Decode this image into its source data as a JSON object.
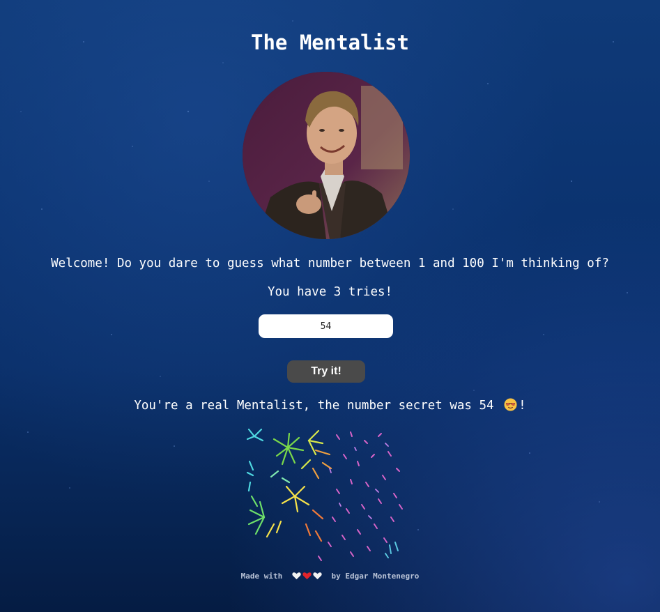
{
  "page": {
    "title": "The Mentalist"
  },
  "intro": {
    "welcome_text": "Welcome! Do you dare to guess what number between 1 and 100 I'm thinking of?",
    "tries_text": "You have 3 tries!"
  },
  "form": {
    "guess_value": "54",
    "try_button_label": "Try it!"
  },
  "result": {
    "message": "You're a real Mentalist, the number secret was 54",
    "emoji": "smiling-face-with-sunglasses",
    "trailing": "!"
  },
  "footer": {
    "made_with": "Made with",
    "hearts": [
      "white-heart",
      "red-heart",
      "white-heart"
    ],
    "by_text": "by Edgar Montenegro"
  },
  "colors": {
    "background": "#0b3370",
    "button": "#4a4a4a",
    "input_bg": "#ffffff",
    "heart_red": "#e0242b",
    "heart_white": "#f2f2f2"
  }
}
